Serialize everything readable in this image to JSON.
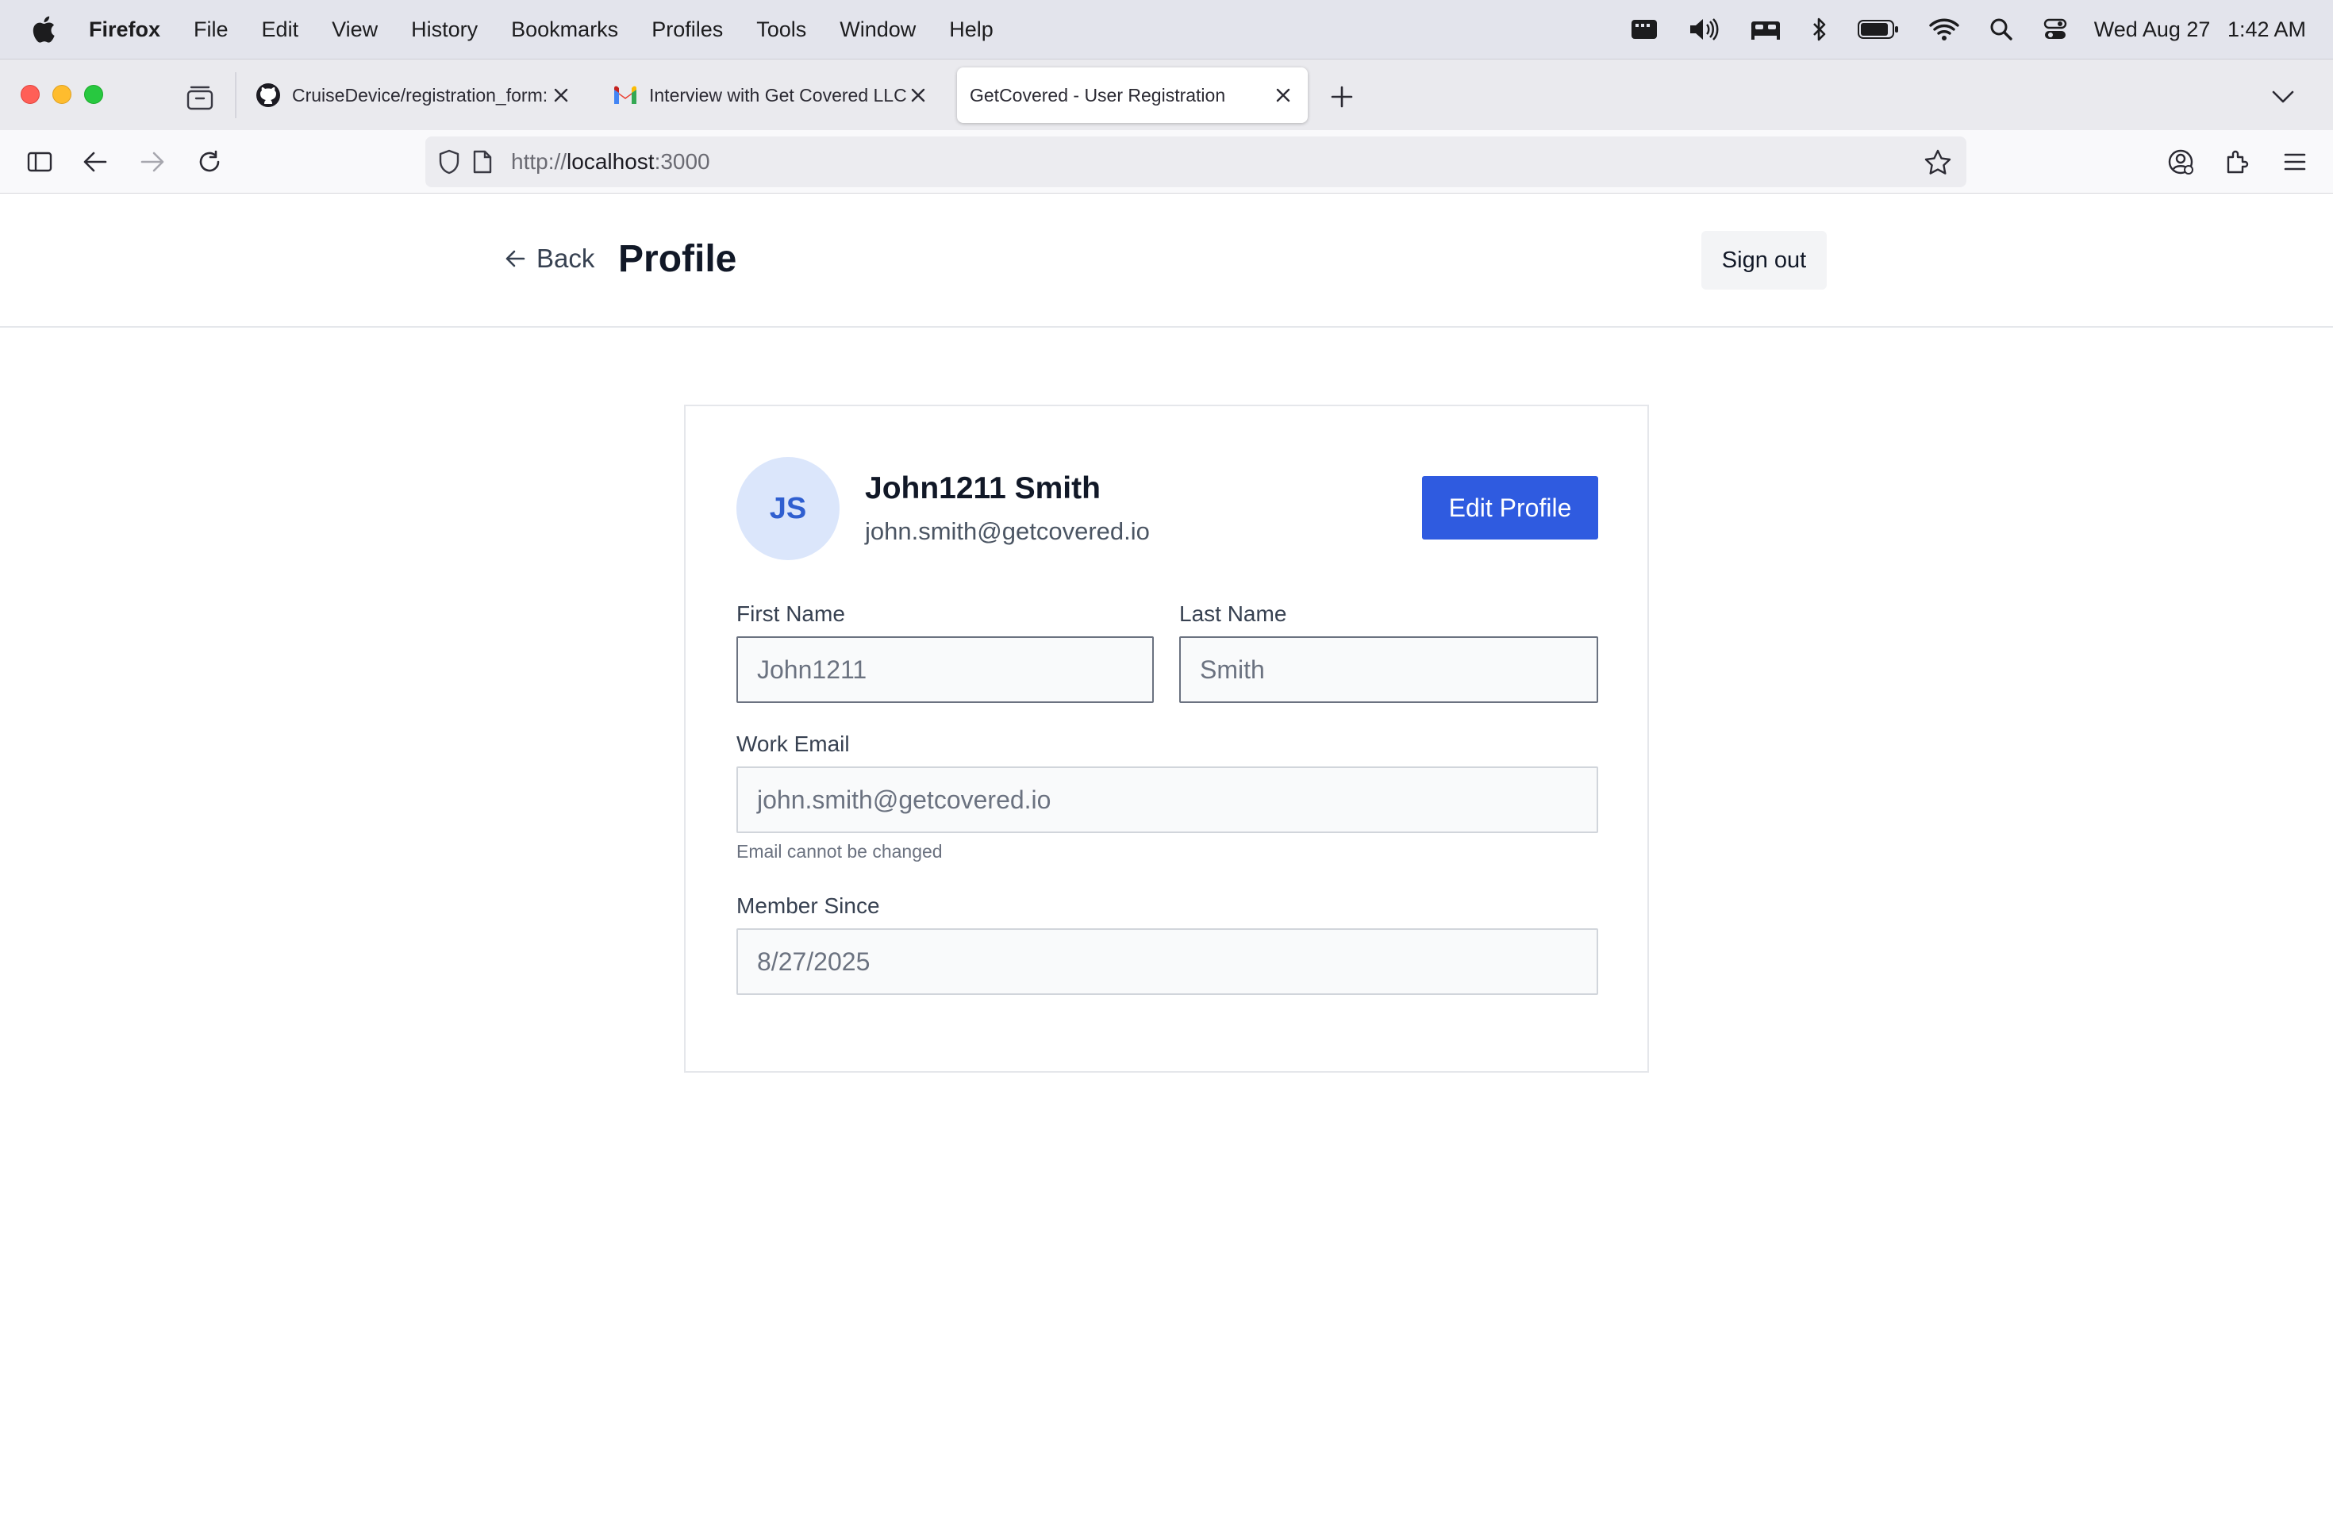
{
  "menubar": {
    "app_name": "Firefox",
    "items": [
      "File",
      "Edit",
      "View",
      "History",
      "Bookmarks",
      "Profiles",
      "Tools",
      "Window",
      "Help"
    ],
    "status_icons": [
      "display-icon",
      "volume-icon",
      "bed-icon",
      "bluetooth-icon",
      "battery-icon",
      "wifi-icon",
      "spotlight-search-icon",
      "control-center-icon"
    ],
    "clock_day": "Wed Aug 27",
    "clock_time": "1:42 AM"
  },
  "tabs": [
    {
      "title": "CruiseDevice/registration_form:",
      "icon": "github-icon",
      "active": false
    },
    {
      "title": "Interview with Get Covered LLC",
      "icon": "gmail-icon",
      "active": false
    },
    {
      "title": "GetCovered - User Registration",
      "icon": "none",
      "active": true
    }
  ],
  "navbar": {
    "url_scheme": "http://",
    "url_host": "localhost",
    "url_port": ":3000"
  },
  "header": {
    "back_label": "Back",
    "title": "Profile",
    "signout_label": "Sign out"
  },
  "profile": {
    "initials": "JS",
    "full_name": "John1211 Smith",
    "email": "john.smith@getcovered.io",
    "edit_label": "Edit Profile",
    "first_name_label": "First Name",
    "first_name_value": "John1211",
    "last_name_label": "Last Name",
    "last_name_value": "Smith",
    "work_email_label": "Work Email",
    "work_email_value": "john.smith@getcovered.io",
    "work_email_hint": "Email cannot be changed",
    "member_since_label": "Member Since",
    "member_since_value": "8/27/2025"
  },
  "colors": {
    "accent": "#2f5be0",
    "avatar_bg": "#dbe6fb",
    "avatar_text": "#2f5fd0"
  }
}
